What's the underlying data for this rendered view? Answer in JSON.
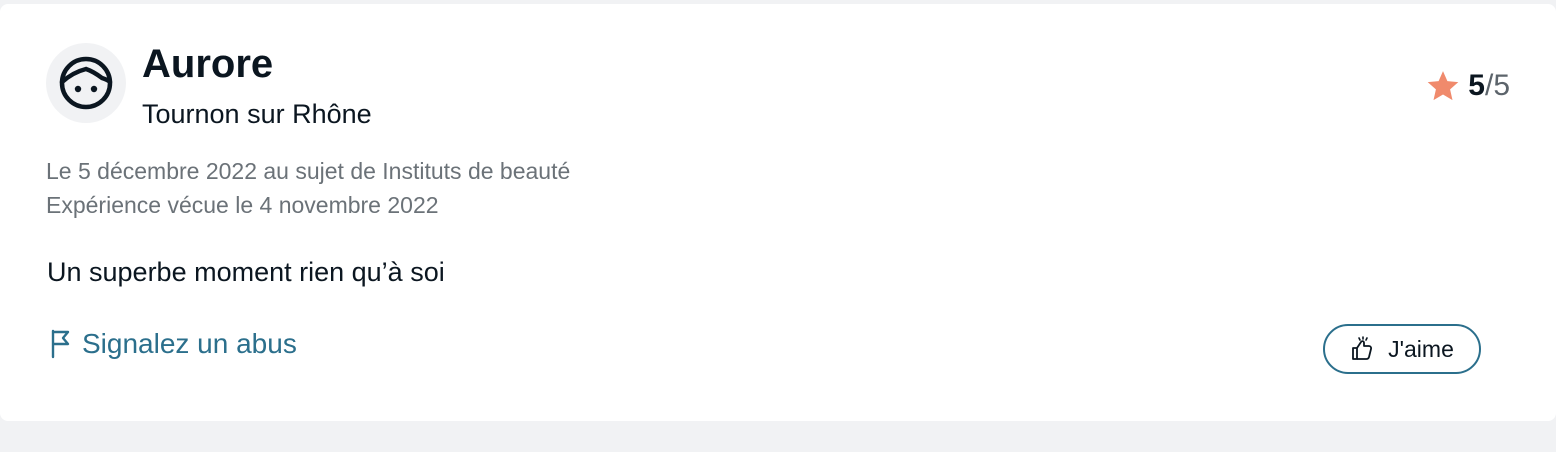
{
  "review": {
    "author_name": "Aurore",
    "author_city": "Tournon sur Rhône",
    "avatar_icon": "face-icon",
    "rating": {
      "score": "5",
      "separator": "/",
      "max": "5",
      "star_color": "#f08a6c",
      "star_icon": "star-icon"
    },
    "meta_line_1": "Le 5 décembre 2022 au sujet de Instituts de beauté",
    "meta_line_2": "Expérience vécue le 4 novembre 2022",
    "title": "Un superbe moment rien qu’à soi",
    "report_label": "Signalez un abus",
    "report_icon": "flag-icon",
    "like_label": "J'aime",
    "like_icon": "thumbs-up-icon"
  },
  "colors": {
    "accent": "#2b6f8c",
    "text": "#0b1620",
    "muted": "#6b7278",
    "background": "#f1f2f4",
    "card": "#ffffff"
  }
}
